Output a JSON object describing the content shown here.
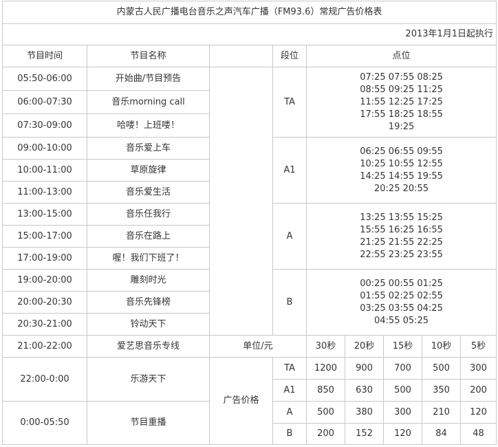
{
  "title": "内蒙古人民广播电台音乐之声汽车广播（FM93.6）常规广告价格表",
  "effective": "2013年1月1日起执行",
  "headers": {
    "time": "节目时间",
    "name": "节目名称",
    "segment": "段位",
    "slots": "点位"
  },
  "programs": [
    {
      "time": "05:50-06:00",
      "name": "开始曲/节目预告"
    },
    {
      "time": "06:00-07:30",
      "name": "音乐morning  call"
    },
    {
      "time": "07:30-09:00",
      "name": "哈喽！上班喽！"
    },
    {
      "time": "09:00-10:00",
      "name": "音乐爱上车"
    },
    {
      "time": "10:00-11:00",
      "name": "草原旋律"
    },
    {
      "time": "11:00-13:00",
      "name": "音乐爱生活"
    },
    {
      "time": "13:00-15:00",
      "name": "音乐任我行"
    },
    {
      "time": "15:00-17:00",
      "name": "音乐在路上"
    },
    {
      "time": "17:00-19:00",
      "name": "喔！我们下班了！"
    },
    {
      "time": "19:00-20:00",
      "name": "雕刻时光"
    },
    {
      "time": "20:00-20:30",
      "name": "音乐先锋榜"
    },
    {
      "time": "20:30-21:00",
      "name": "铃动天下"
    },
    {
      "time": "21:00-22:00",
      "name": "爱艺思音乐专线"
    },
    {
      "time": "22:00-0:00",
      "name": "乐游天下"
    },
    {
      "time": "0:00-05:50",
      "name": "节目重播"
    }
  ],
  "segments": [
    {
      "code": "TA",
      "slot_lines": [
        "07:25 07:55 08:25",
        "08:55 09:25 11:25",
        "11:55 12:25 17:25",
        "17:55 18:25 18:55",
        "19:25"
      ]
    },
    {
      "code": "A1",
      "slot_lines": [
        "06:25 06:55 09:55",
        "10:25 10:55 12:55",
        "14:25 14:55 19:55",
        "20:25 20:55"
      ]
    },
    {
      "code": "A",
      "slot_lines": [
        "13:25   13:55 15:25",
        "15:55 16:25 16:55",
        "21:25 21:55 22:25",
        "22:55 23:25 23:55"
      ]
    },
    {
      "code": "B",
      "slot_lines": [
        "00:25 00:55 01:25",
        "01:55 02:25   02:55",
        "03:25 03:55 04:25",
        "04:55 05:25"
      ]
    }
  ],
  "pricing": {
    "unit_label": "单位/元",
    "row_label": "广告价格",
    "durations": [
      "30秒",
      "20秒",
      "15秒",
      "10秒",
      "5秒"
    ],
    "rows": [
      {
        "segment": "TA",
        "prices": [
          "1200",
          "900",
          "700",
          "500",
          "300"
        ]
      },
      {
        "segment": "A1",
        "prices": [
          "850",
          "630",
          "500",
          "350",
          "200"
        ]
      },
      {
        "segment": "A",
        "prices": [
          "500",
          "380",
          "300",
          "210",
          "120"
        ]
      },
      {
        "segment": "B",
        "prices": [
          "200",
          "152",
          "120",
          "84",
          "48"
        ]
      }
    ]
  }
}
